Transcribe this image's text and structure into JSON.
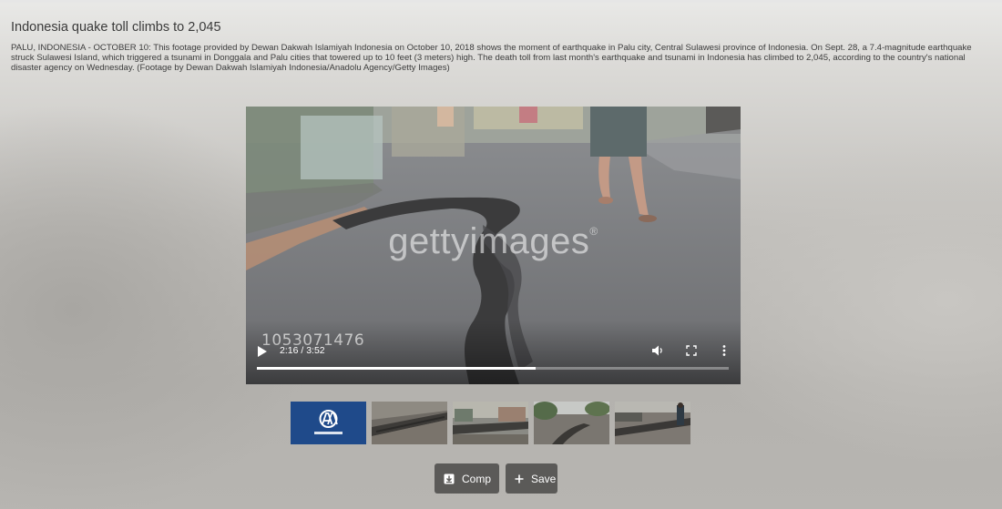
{
  "header": {
    "title": "Indonesia quake toll climbs to 2,045",
    "caption": "PALU, INDONESIA - OCTOBER 10: This footage provided by Dewan Dakwah Islamiyah Indonesia on October 10, 2018 shows the moment of earthquake in Palu city, Central Sulawesi province of Indonesia. On Sept. 28, a 7.4-magnitude earthquake struck Sulawesi Island, which triggered a tsunami in Donggala and Palu cities that towered up to 10 feet (3 meters) high. The death toll from last month's earthquake and tsunami in Indonesia has climbed to 2,045, according to the country's national disaster agency on Wednesday. (Footage by Dewan Dakwah Islamiyah Indonesia/Anadolu Agency/Getty Images)"
  },
  "player": {
    "watermark": "gettyimages",
    "watermark_mark": "®",
    "clip_id": "1053071476",
    "time_display": "2:16 / 3:52",
    "progress_fraction": 0.59,
    "icons": [
      "play-icon",
      "volume-icon",
      "fullscreen-icon",
      "more-options-icon"
    ]
  },
  "thumbnails": [
    {
      "kind": "logo",
      "label": "ANADOLU AGENCY",
      "bg": "#1f4a8a"
    },
    {
      "kind": "frame",
      "description": "cracked road"
    },
    {
      "kind": "frame",
      "description": "street with houses"
    },
    {
      "kind": "frame",
      "description": "road crack with trees"
    },
    {
      "kind": "frame",
      "description": "damaged road with person"
    }
  ],
  "actions": {
    "comp_label": "Comp",
    "save_label": "Save",
    "comp_icon": "download-icon",
    "save_icon": "plus-icon"
  },
  "colors": {
    "button_bg": "#5b5a58",
    "progress_fill": "#ffffff",
    "logo_bg": "#1f4a8a"
  }
}
